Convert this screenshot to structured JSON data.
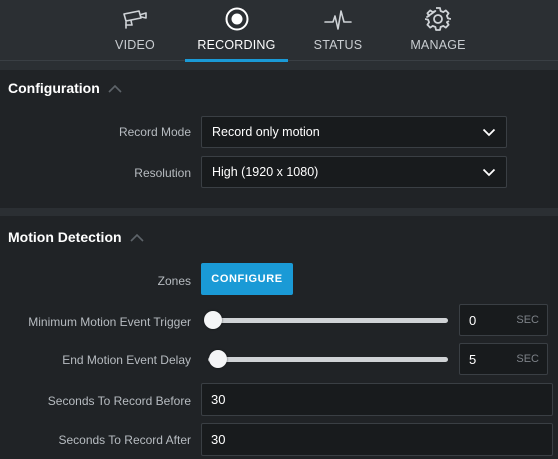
{
  "tabs": [
    {
      "label": "VIDEO",
      "icon": "camera-icon",
      "active": false
    },
    {
      "label": "RECORDING",
      "icon": "record-icon",
      "active": true
    },
    {
      "label": "STATUS",
      "icon": "pulse-icon",
      "active": false
    },
    {
      "label": "MANAGE",
      "icon": "gear-icon",
      "active": false
    }
  ],
  "configuration": {
    "title": "Configuration",
    "record_mode": {
      "label": "Record Mode",
      "value": "Record only motion"
    },
    "resolution": {
      "label": "Resolution",
      "value": "High (1920 x 1080)"
    }
  },
  "motion": {
    "title": "Motion Detection",
    "zones": {
      "label": "Zones",
      "button": "CONFIGURE"
    },
    "min_trigger": {
      "label": "Minimum Motion Event Trigger",
      "value": "0",
      "unit": "SEC",
      "level": 0
    },
    "end_delay": {
      "label": "End Motion Event Delay",
      "value": "5",
      "unit": "SEC",
      "level": 0.02
    },
    "record_before": {
      "label": "Seconds To Record Before",
      "value": "30"
    },
    "record_after": {
      "label": "Seconds To Record After",
      "value": "30"
    }
  },
  "colors": {
    "accent": "#1a9ad6",
    "panel": "#202326",
    "background": "#2b2f33"
  }
}
